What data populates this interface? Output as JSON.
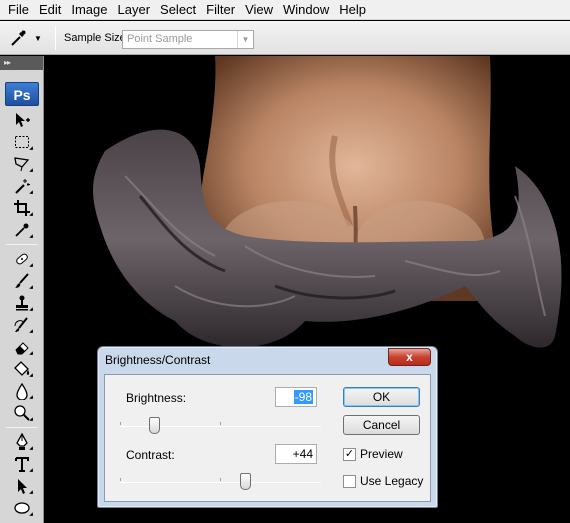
{
  "menu": [
    "File",
    "Edit",
    "Image",
    "Layer",
    "Select",
    "Filter",
    "View",
    "Window",
    "Help"
  ],
  "options_bar": {
    "tool_icon": "eyedropper-icon",
    "sample_size_label": "Sample Size:",
    "sample_size_value": "Point Sample"
  },
  "tools_panel": {
    "header": "▸▸",
    "logo": "Ps",
    "tools": [
      "move-icon",
      "marquee-icon",
      "lasso-icon",
      "magic-wand-icon",
      "crop-icon",
      "eyedropper-icon",
      "healing-brush-icon",
      "brush-icon",
      "clone-stamp-icon",
      "history-brush-icon",
      "eraser-icon",
      "paint-bucket-icon",
      "blur-icon",
      "dodge-icon",
      "pen-icon",
      "type-icon",
      "path-selection-icon",
      "ellipse-icon"
    ]
  },
  "dialog": {
    "title": "Brightness/Contrast",
    "close": "x",
    "brightness_label": "Brightness:",
    "brightness_value": "-98",
    "brightness": -98,
    "brightness_range": [
      -150,
      150
    ],
    "contrast_label": "Contrast:",
    "contrast_value": "+44",
    "contrast": 44,
    "contrast_range": [
      -50,
      100
    ],
    "ok": "OK",
    "cancel": "Cancel",
    "preview_label": "Preview",
    "preview_checked": true,
    "legacy_label": "Use Legacy",
    "legacy_checked": false
  },
  "colors": {
    "dialog_frame": "#c9d8ea",
    "close_button": "#c8422f",
    "selection": "#3399ff"
  }
}
